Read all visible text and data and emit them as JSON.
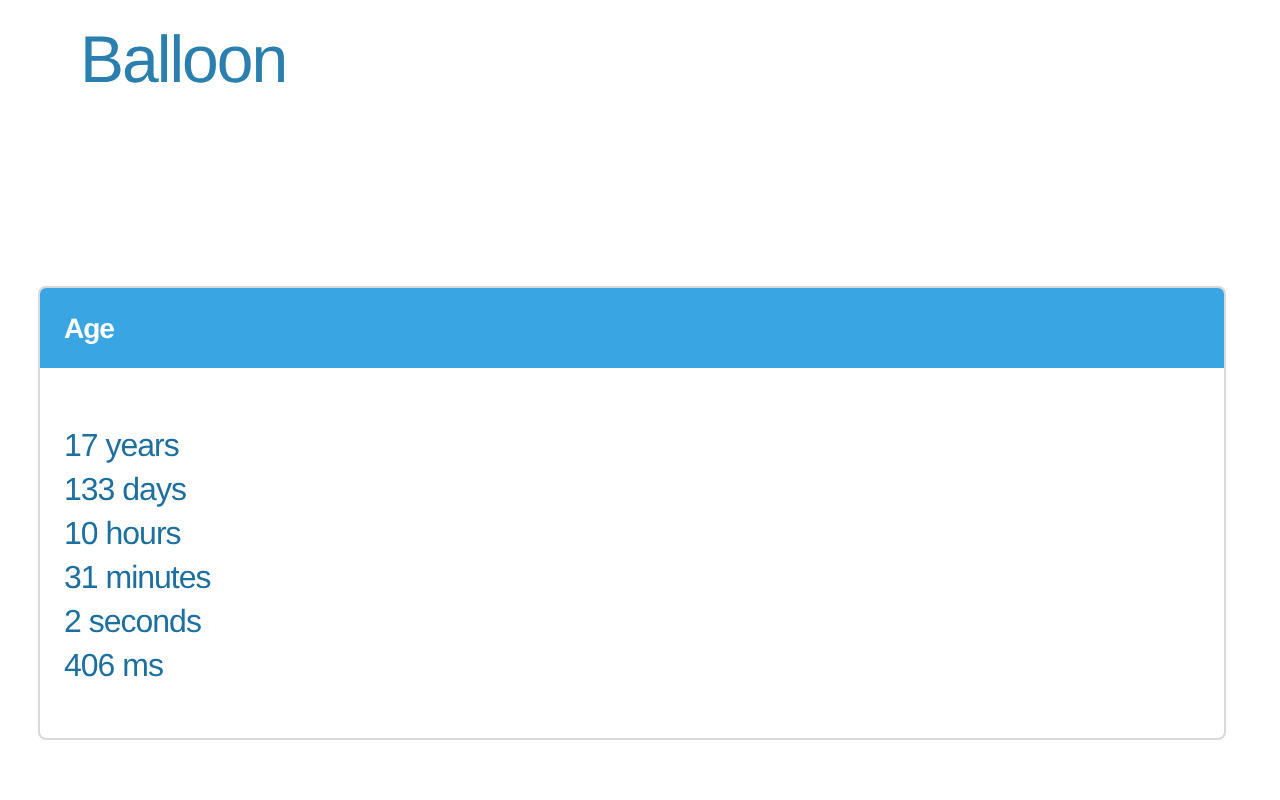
{
  "title": "Balloon",
  "panel": {
    "heading": "Age",
    "lines": [
      "17 years",
      "133 days",
      "10 hours",
      "31 minutes",
      "2 seconds",
      "406 ms"
    ]
  }
}
